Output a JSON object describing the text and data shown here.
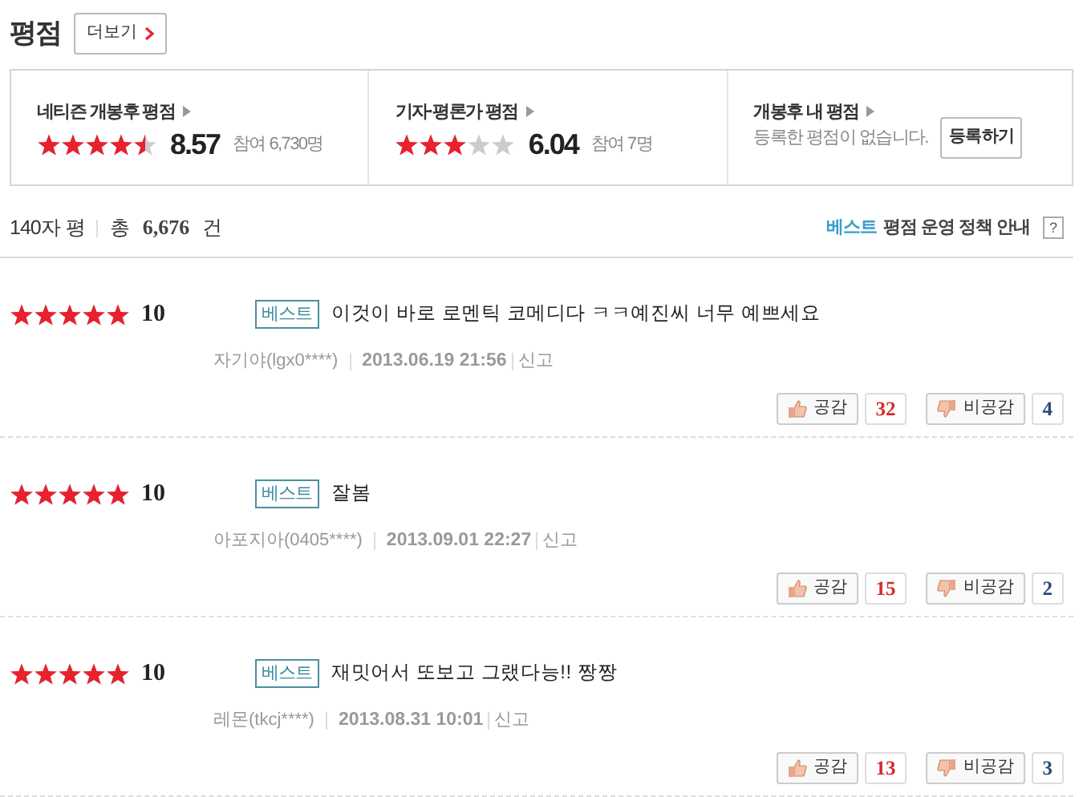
{
  "header": {
    "title": "평점",
    "more_button": "더보기"
  },
  "summary": [
    {
      "kind": "score",
      "title": "네티즌 개봉후 평점",
      "stars": 4.5,
      "score": "8.57",
      "count": "참여 6,730명"
    },
    {
      "kind": "score",
      "title": "기자·평론가 평점",
      "stars": 3,
      "score": "6.04",
      "count": "참여 7명"
    },
    {
      "kind": "mine",
      "title": "개봉후 내 평점",
      "message": "등록한 평점이 없습니다.",
      "button": "등록하기"
    }
  ],
  "list_header": {
    "label": "140자 평",
    "total_label": "총",
    "total": "6,676",
    "unit": "건",
    "best_word": "베스트",
    "policy": "평점 운영 정책 안내",
    "help": "?"
  },
  "reviews": [
    {
      "stars": 5,
      "score": "10",
      "badge": "베스트",
      "text": "이것이 바로 로멘틱 코메디다 ㅋㅋ예진씨 너무 예쁘세요",
      "author": "자기야(lgx0****)",
      "date": "2013.06.19 21:56",
      "report": "신고",
      "like_label": "공감",
      "likes": "32",
      "dislike_label": "비공감",
      "dislikes": "4"
    },
    {
      "stars": 5,
      "score": "10",
      "badge": "베스트",
      "text": "잘봄",
      "author": "아포지아(0405****)",
      "date": "2013.09.01 22:27",
      "report": "신고",
      "like_label": "공감",
      "likes": "15",
      "dislike_label": "비공감",
      "dislikes": "2"
    },
    {
      "stars": 5,
      "score": "10",
      "badge": "베스트",
      "text": "재밋어서 또보고 그랬다능!! 짱짱",
      "author": "레몬(tkcj****)",
      "date": "2013.08.31 10:01",
      "report": "신고",
      "like_label": "공감",
      "likes": "13",
      "dislike_label": "비공감",
      "dislikes": "3"
    }
  ]
}
